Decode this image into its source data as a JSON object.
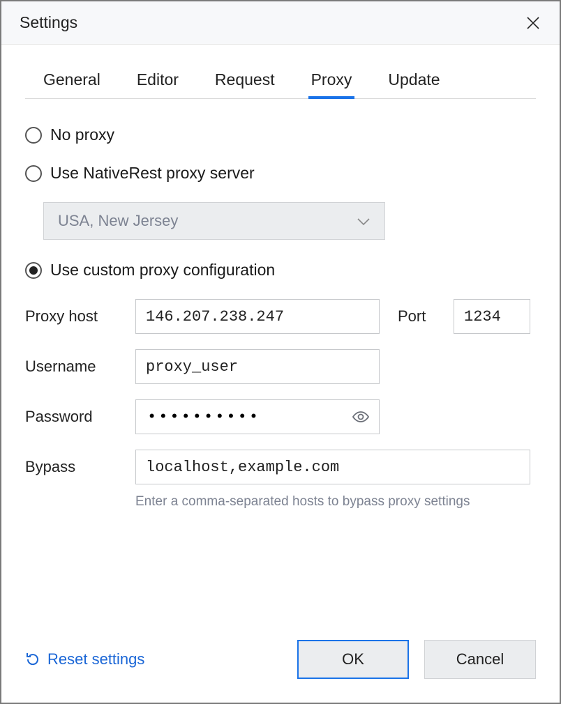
{
  "window": {
    "title": "Settings"
  },
  "tabs": {
    "general": "General",
    "editor": "Editor",
    "request": "Request",
    "proxy": "Proxy",
    "update": "Update"
  },
  "proxy": {
    "option_none": "No proxy",
    "option_nativerest": "Use NativeRest proxy server",
    "option_custom": "Use custom proxy configuration",
    "server_select_value": "USA, New Jersey",
    "labels": {
      "host": "Proxy host",
      "port": "Port",
      "username": "Username",
      "password": "Password",
      "bypass": "Bypass"
    },
    "values": {
      "host": "146.207.238.247",
      "port": "1234",
      "username": "proxy_user",
      "password": "••••••••••",
      "bypass": "localhost,example.com"
    },
    "bypass_hint": "Enter a comma-separated hosts to bypass proxy settings"
  },
  "footer": {
    "reset": "Reset settings",
    "ok": "OK",
    "cancel": "Cancel"
  }
}
